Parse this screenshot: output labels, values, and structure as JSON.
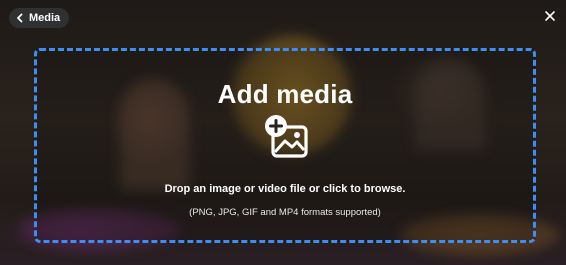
{
  "header": {
    "back_label": "Media",
    "back_icon": "chevron-left-icon",
    "close_icon": "close-icon"
  },
  "dropzone": {
    "title": "Add media",
    "icon": "add-image-icon",
    "instruction": "Drop an image or video file or click to browse.",
    "formats": "(PNG, JPG, GIF and MP4 formats supported)",
    "border_color": "#3d8ef0"
  }
}
